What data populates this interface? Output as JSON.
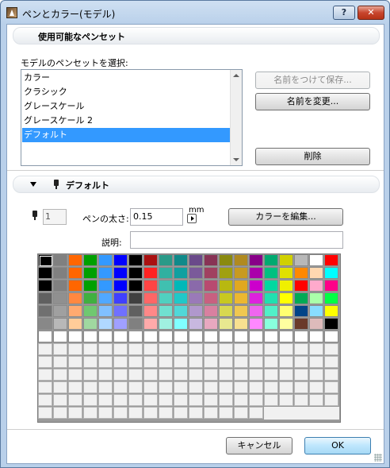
{
  "window": {
    "title": "ペンとカラー(モデル)",
    "help_label": "?",
    "close_label": "✕"
  },
  "penset_section": {
    "header": "使用可能なペンセット",
    "select_label": "モデルのペンセットを選択:",
    "items": [
      "カラー",
      "クラシック",
      "グレースケール",
      "グレースケール 2",
      "デフォルト"
    ],
    "selected_index": 4,
    "save_as_label": "名前をつけて保存...",
    "rename_label": "名前を変更...",
    "delete_label": "削除"
  },
  "pen_section": {
    "header": "デフォルト",
    "pen_number": "1",
    "weight_label": "ペンの太さ:",
    "weight_value": "0.15",
    "unit": "mm",
    "edit_color_label": "カラーを編集...",
    "description_label": "説明:",
    "description_value": ""
  },
  "palette": {
    "columns": 20,
    "rows": 13,
    "selected": [
      0,
      0
    ],
    "colors": [
      [
        "#000000",
        "#808080",
        "#ff6600",
        "#00a000",
        "#3399ff",
        "#0000ff",
        "#000000",
        "#aa1111",
        "#2a9a88",
        "#108a8a",
        "#6a4a8a",
        "#883355",
        "#8a8a10",
        "#b08a20",
        "#880088",
        "#00aa70",
        "#d0d000",
        "#b8b8b8",
        "#ffffff",
        "#ff0000"
      ],
      [
        "#000000",
        "#808080",
        "#ff6600",
        "#00a000",
        "#3399ff",
        "#0000ff",
        "#000000",
        "#ff2222",
        "#30b0a0",
        "#10a0a0",
        "#7a5a9a",
        "#a04060",
        "#a0a010",
        "#c89a20",
        "#aa00aa",
        "#00c080",
        "#e0e000",
        "#ff8800",
        "#ffd8b0",
        "#00ffff"
      ],
      [
        "#000000",
        "#808080",
        "#ff6600",
        "#00a000",
        "#3399ff",
        "#0000ff",
        "#000000",
        "#ff4444",
        "#40c0b0",
        "#00b8b8",
        "#8a6aaa",
        "#b84a70",
        "#b8b810",
        "#e0a820",
        "#cc00cc",
        "#00d8a0",
        "#f0f000",
        "#ff0000",
        "#ffaacc",
        "#ff0088"
      ],
      [
        "#606060",
        "#909090",
        "#ff8840",
        "#40b040",
        "#50a8ff",
        "#4040ff",
        "#404040",
        "#ff6666",
        "#50d0c0",
        "#20c8c8",
        "#9a7ab8",
        "#c86080",
        "#c8c820",
        "#ecb830",
        "#dd22dd",
        "#20e0b0",
        "#ffff00",
        "#00aa55",
        "#aaffaa",
        "#00ff44"
      ],
      [
        "#707070",
        "#a0a0a0",
        "#ffaa70",
        "#70c870",
        "#80c0ff",
        "#7070ff",
        "#606060",
        "#ff8888",
        "#70e0d0",
        "#50d8d8",
        "#b098cc",
        "#d880a0",
        "#d8d850",
        "#f0c850",
        "#ee66ee",
        "#50f0c8",
        "#ffff70",
        "#004488",
        "#88ddff",
        "#ffff00"
      ],
      [
        "#888888",
        "#b8b8b8",
        "#ffcc99",
        "#a0d8a0",
        "#b0d8ff",
        "#a0a0ff",
        "#808080",
        "#ffaaaa",
        "#a0f0e0",
        "#80ffff",
        "#c8b8e0",
        "#e8a8c0",
        "#e8e890",
        "#f8e090",
        "#ff88ff",
        "#88ffdd",
        "#ffffa0",
        "#6a3a2a",
        "#ddbbbb",
        "#000000"
      ],
      [
        "#ffffff",
        "#ffffff",
        "#ffffff",
        "#ffffff",
        "#ffffff",
        "#ffffff",
        "#ffffff",
        "#ffffff",
        "#ffffff",
        "#ffffff",
        "#ffffff",
        "#ffffff",
        "#ffffff",
        "#ffffff",
        "#ffffff",
        "#ffffff",
        "#ffffff",
        "#ffffff",
        "#ffffff",
        "#ffffff"
      ]
    ]
  },
  "footer": {
    "cancel_label": "キャンセル",
    "ok_label": "OK"
  }
}
